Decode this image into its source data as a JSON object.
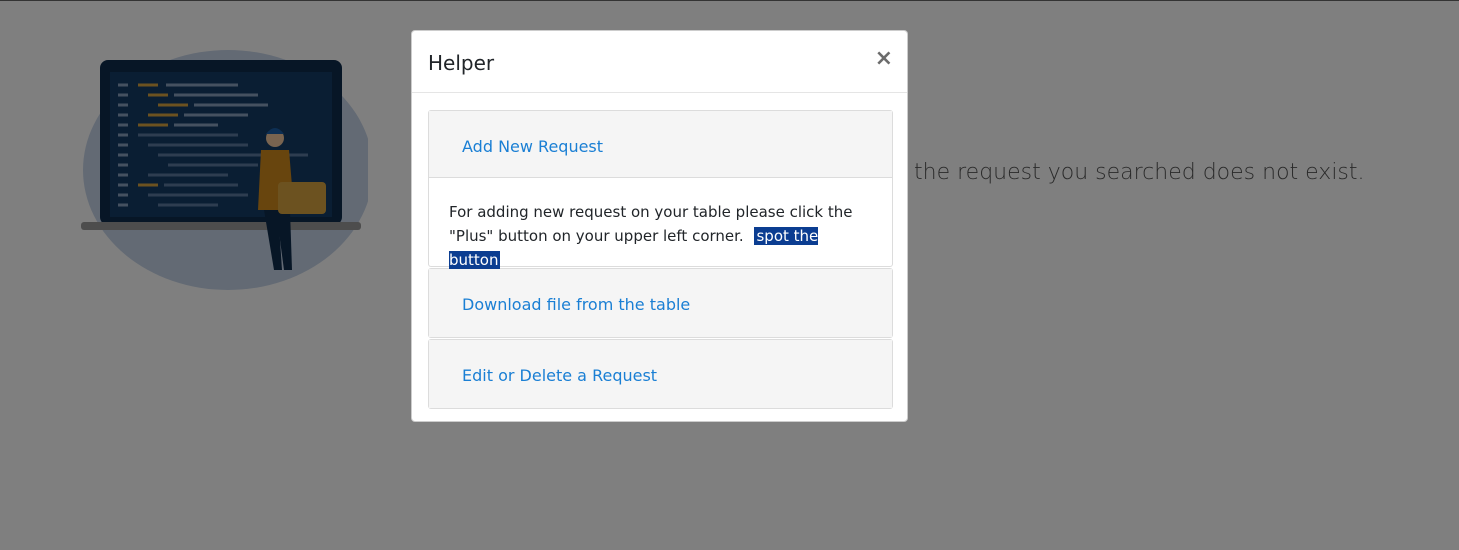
{
  "background_page": {
    "message": "the request you searched does not exist."
  },
  "modal": {
    "title": "Helper",
    "close_label": "×",
    "sections": [
      {
        "title": "Add New Request",
        "expanded": true,
        "body_text": "For adding new request on your table please click the \"Plus\" button on your upper left corner.",
        "body_link": "spot the button"
      },
      {
        "title": "Download file from the table",
        "expanded": false
      },
      {
        "title": "Edit or Delete a Request",
        "expanded": false
      }
    ]
  },
  "colors": {
    "link": "#1a7fd4",
    "highlight_bg": "#0b3d91",
    "overlay": "rgba(0,0,0,0.5)"
  }
}
